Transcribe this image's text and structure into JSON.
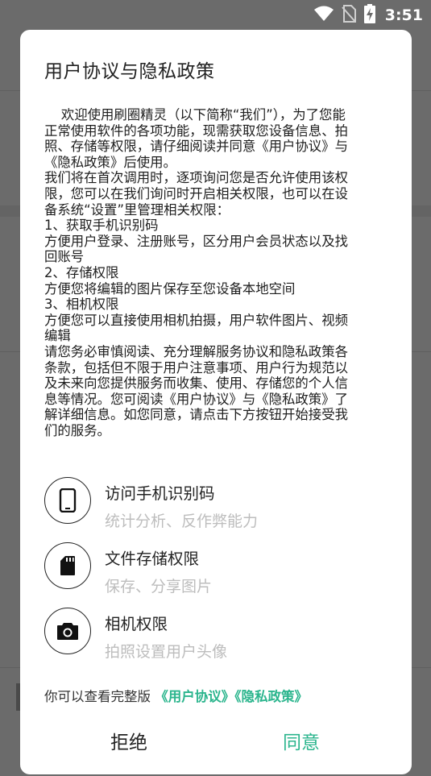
{
  "status_bar": {
    "time": "3:51",
    "icons": [
      "wifi-icon",
      "no-sim-icon",
      "battery-charging-icon"
    ]
  },
  "dialog": {
    "title": "用户协议与隐私政策",
    "body": [
      "    欢迎使用刷圈精灵（以下简称“我们”），为了您能",
      "正常使用软件的各项功能，现需获取您设备信息、拍",
      "照、存储等权限，请仔细阅读并同意《用户协议》与",
      "《隐私政策》后使用。",
      "我们将在首次调用时，逐项询问您是否允许使用该权",
      "限，您可以在我们询问时开启相关权限，也可以在设",
      "备系统“设置”里管理相关权限：",
      "1、获取手机识别码",
      "方便用户登录、注册账号，区分用户会员状态以及找",
      "回账号",
      "2、存储权限",
      "方便您将编辑的图片保存至您设备本地空间",
      "3、相机权限",
      "方便您可以直接使用相机拍摄，用户软件图片、视频",
      "编辑",
      "请您务必审慎阅读、充分理解服务协议和隐私政策各",
      "条款，包括但不限于用户注意事项、用户行为规范以",
      "及未来向您提供服务而收集、使用、存储您的个人信",
      "息等情况。您可阅读《用户协议》与《隐私政策》了",
      "解详细信息。如您同意，请点击下方按钮开始接受我",
      "们的服务。"
    ],
    "permissions": [
      {
        "icon": "phone-icon",
        "title": "访问手机识别码",
        "desc": "统计分析、反作弊能力"
      },
      {
        "icon": "sd-card-icon",
        "title": "文件存储权限",
        "desc": "保存、分享图片"
      },
      {
        "icon": "camera-icon",
        "title": "相机权限",
        "desc": "拍照设置用户头像"
      }
    ],
    "links_prefix": "你可以查看完整版",
    "link_agreement": "《用户协议》",
    "link_privacy": "《隐私政策》",
    "reject_label": "拒绝",
    "agree_label": "同意"
  },
  "colors": {
    "accent": "#2bb58d",
    "overlay": "#6b6b6b"
  }
}
